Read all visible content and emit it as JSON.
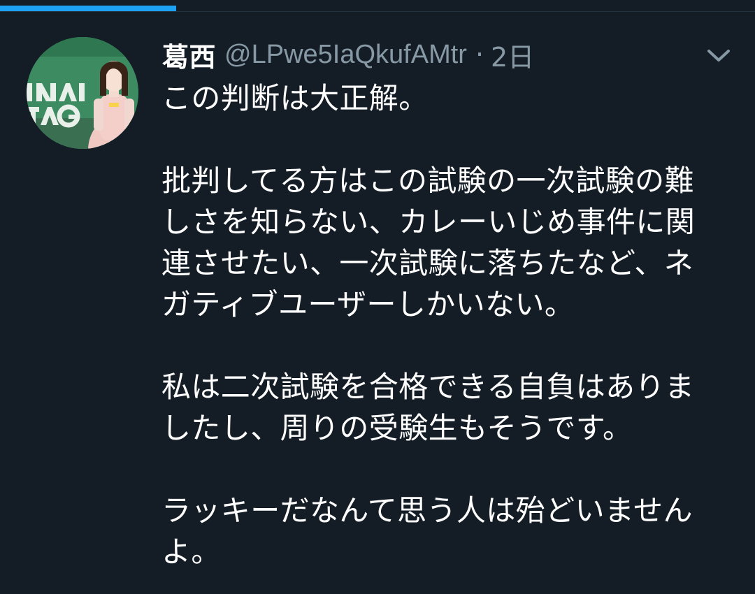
{
  "progress": {
    "fraction": 0.233
  },
  "tweet": {
    "display_name": "葛西",
    "handle": "@LPwe5IaQkufAMtr",
    "separator": "·",
    "time_ago": "2日",
    "menu_icon": "chevron-down-icon",
    "avatar_icon": "profile-photo",
    "text_lines": [
      "この判断は大正解。",
      "",
      "批判してる方はこの試験の一次試験の難",
      "しさを知らない、カレーいじめ事件に関",
      "連させたい、一次試験に落ちたなど、ネ",
      "ガティブユーザーしかいない。",
      "",
      "私は二次試験を合格できる自負はありま",
      "したし、周りの受験生もそうです。",
      "",
      "ラッキーだなんて思う人は殆どいません",
      "よ。"
    ]
  },
  "colors": {
    "background": "#141d26",
    "accent": "#1da1f2",
    "text": "#ffffff",
    "muted": "#8899a6"
  }
}
